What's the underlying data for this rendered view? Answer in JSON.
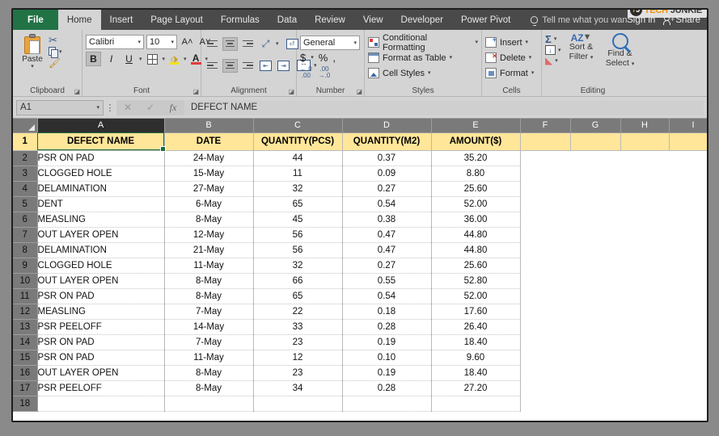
{
  "app": {
    "tabs": [
      {
        "label": "File",
        "state": "file"
      },
      {
        "label": "Home",
        "state": "active"
      },
      {
        "label": "Insert",
        "state": "normal"
      },
      {
        "label": "Page Layout",
        "state": "normal"
      },
      {
        "label": "Formulas",
        "state": "normal"
      },
      {
        "label": "Data",
        "state": "normal"
      },
      {
        "label": "Review",
        "state": "normal"
      },
      {
        "label": "View",
        "state": "normal"
      },
      {
        "label": "Developer",
        "state": "normal"
      },
      {
        "label": "Power Pivot",
        "state": "normal"
      }
    ],
    "tellme": "Tell me what you want to d",
    "signin": "Sign in",
    "share": "Share",
    "watermark": {
      "logo_t": "T",
      "logo_j": "J",
      "tech": "TECH",
      "junkie": "JUNKIE"
    }
  },
  "ribbon": {
    "clipboard": {
      "label": "Clipboard",
      "paste": "Paste",
      "cut": "Cut",
      "copy": "Copy",
      "format_painter": "Format Painter"
    },
    "font": {
      "label": "Font",
      "font_name": "Calibri",
      "font_size": "10",
      "bold": "B",
      "italic": "I",
      "underline": "U",
      "grow_font": "A",
      "shrink_font": "A",
      "font_color_letter": "A"
    },
    "alignment": {
      "label": "Alignment"
    },
    "number": {
      "label": "Number",
      "format": "General",
      "currency": "$",
      "percent": "%",
      "comma": ","
    },
    "styles": {
      "label": "Styles",
      "items": [
        "Conditional Formatting",
        "Format as Table",
        "Cell Styles"
      ]
    },
    "cells": {
      "label": "Cells",
      "items": [
        "Insert",
        "Delete",
        "Format"
      ]
    },
    "editing": {
      "label": "Editing",
      "autosum": "Σ",
      "sort_filter_1": "Sort &",
      "sort_filter_2": "Filter",
      "find_select_1": "Find &",
      "find_select_2": "Select"
    }
  },
  "formula_bar": {
    "name_box": "A1",
    "cancel": "✕",
    "enter": "✓",
    "fx": "fx",
    "content": "DEFECT NAME"
  },
  "sheet": {
    "column_headers": [
      "A",
      "B",
      "C",
      "D",
      "E",
      "F",
      "G",
      "H",
      "I"
    ],
    "selected_column": "A",
    "selected_cell": "A1",
    "header_row_number": "1",
    "headers": [
      "DEFECT NAME",
      "DATE",
      "QUANTITY(PCS)",
      "QUANTITY(M2)",
      "AMOUNT($)"
    ],
    "rows": [
      {
        "n": "2",
        "cells": [
          "PSR ON PAD",
          "24-May",
          "44",
          "0.37",
          "35.20"
        ]
      },
      {
        "n": "3",
        "cells": [
          "CLOGGED HOLE",
          "15-May",
          "11",
          "0.09",
          "8.80"
        ]
      },
      {
        "n": "4",
        "cells": [
          "DELAMINATION",
          "27-May",
          "32",
          "0.27",
          "25.60"
        ]
      },
      {
        "n": "5",
        "cells": [
          "DENT",
          "6-May",
          "65",
          "0.54",
          "52.00"
        ]
      },
      {
        "n": "6",
        "cells": [
          "MEASLING",
          "8-May",
          "45",
          "0.38",
          "36.00"
        ]
      },
      {
        "n": "7",
        "cells": [
          "OUT LAYER OPEN",
          "12-May",
          "56",
          "0.47",
          "44.80"
        ]
      },
      {
        "n": "8",
        "cells": [
          "DELAMINATION",
          "21-May",
          "56",
          "0.47",
          "44.80"
        ]
      },
      {
        "n": "9",
        "cells": [
          "CLOGGED HOLE",
          "11-May",
          "32",
          "0.27",
          "25.60"
        ]
      },
      {
        "n": "10",
        "cells": [
          "OUT LAYER OPEN",
          "8-May",
          "66",
          "0.55",
          "52.80"
        ]
      },
      {
        "n": "11",
        "cells": [
          "PSR ON PAD",
          "8-May",
          "65",
          "0.54",
          "52.00"
        ]
      },
      {
        "n": "12",
        "cells": [
          "MEASLING",
          "7-May",
          "22",
          "0.18",
          "17.60"
        ]
      },
      {
        "n": "13",
        "cells": [
          "PSR PEELOFF",
          "14-May",
          "33",
          "0.28",
          "26.40"
        ]
      },
      {
        "n": "14",
        "cells": [
          "PSR ON PAD",
          "7-May",
          "23",
          "0.19",
          "18.40"
        ]
      },
      {
        "n": "15",
        "cells": [
          "PSR ON PAD",
          "11-May",
          "12",
          "0.10",
          "9.60"
        ]
      },
      {
        "n": "16",
        "cells": [
          "OUT LAYER OPEN",
          "8-May",
          "23",
          "0.19",
          "18.40"
        ]
      },
      {
        "n": "17",
        "cells": [
          "PSR PEELOFF",
          "8-May",
          "34",
          "0.28",
          "27.20"
        ]
      },
      {
        "n": "18",
        "cells": [
          "",
          "",
          "",
          "",
          ""
        ]
      }
    ]
  },
  "colors": {
    "file_tab_green": "#217346",
    "header_fill": "#ffe699",
    "selection_green": "#1e6b41",
    "ribbon_gray": "#d4d4d4",
    "accent_orange": "#f0920a"
  }
}
